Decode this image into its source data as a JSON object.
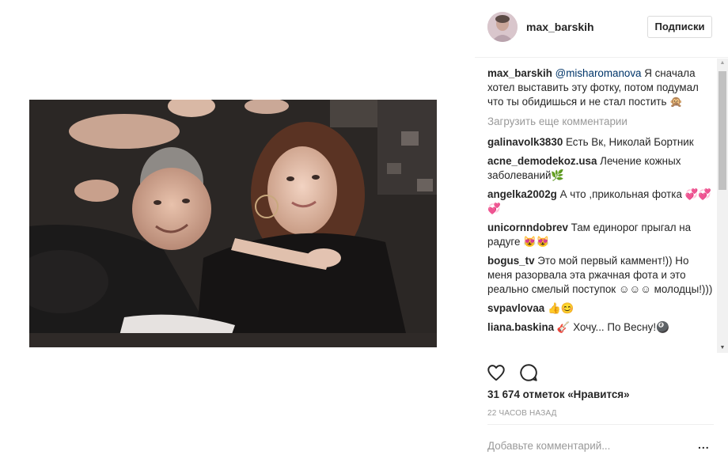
{
  "post": {
    "username": "max_barskih",
    "follow_label": "Подписки",
    "likes": "31 674 отметок «Нравится»",
    "time": "22 ЧАСОВ НАЗАД",
    "comment_placeholder": "Добавьте комментарий...",
    "more": "..."
  },
  "caption": {
    "user": "max_barskih",
    "mention": "@misharomanova",
    "text": " Я сначала хотел выставить эту фотку, потом подумал что ты обидишься и не стал постить 🙊"
  },
  "load_more": "Загрузить еще комментарии",
  "comments": [
    {
      "user": "galinavolk3830",
      "text": " Есть Вк, Николай Бортник"
    },
    {
      "user": "acne_demodekoz.usa",
      "text": " Лечение кожных заболеваний🌿"
    },
    {
      "user": "angelka2002g",
      "text": " А что ,прикольная фотка 💞💞💞"
    },
    {
      "user": "unicornndobrev",
      "text": " Там единорог прыгал на радуге 😻😻"
    },
    {
      "user": "bogus_tv",
      "text": " Это мой первый каммент!)) Но меня разорвала эта ржачная фота и это реально смелый поступок ☺☺☺ молодцы!)))"
    },
    {
      "user": "svpavlovaa",
      "text": " 👍😊"
    },
    {
      "user": "liana.baskina",
      "text": " 🎸 Хочу... По Весну!🎱"
    }
  ],
  "icons": {
    "like": "heart-outline-icon",
    "comment": "comment-bubble-icon",
    "more": "ellipsis-icon"
  }
}
